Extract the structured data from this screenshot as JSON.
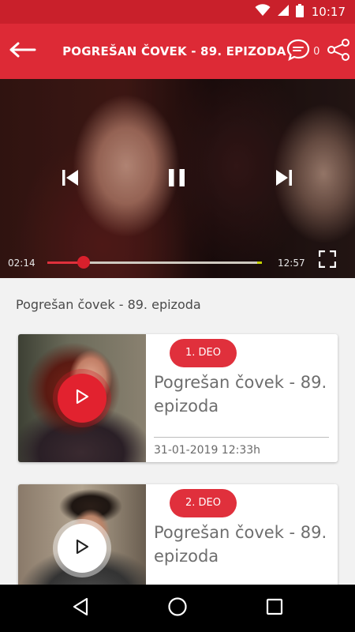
{
  "status_bar": {
    "time": "10:17",
    "icons": [
      "wifi-icon",
      "cell-signal-icon",
      "battery-icon"
    ]
  },
  "app_bar": {
    "title": "POGREŠAN ČOVEK - 89. EPIZODA",
    "comment_count": "0",
    "icons": {
      "back": "arrow-left-icon",
      "comments": "chat-bubble-icon",
      "share": "share-icon"
    }
  },
  "player": {
    "current_time": "02:14",
    "duration": "12:57",
    "progress": 0.17,
    "controls": [
      "skip-previous-icon",
      "pause-icon",
      "skip-next-icon",
      "fullscreen-icon"
    ]
  },
  "episode": {
    "title": "Pogrešan čovek - 89. epizoda",
    "parts": [
      {
        "badge": "1. DEO",
        "title": "Pogrešan čovek - 89. epizoda",
        "date": "31-01-2019 12:33h",
        "playing": true
      },
      {
        "badge": "2. DEO",
        "title": "Pogrešan čovek - 89. epizoda",
        "date": "",
        "playing": false
      }
    ]
  },
  "nav_bar": {
    "icons": [
      "back-triangle-icon",
      "home-circle-icon",
      "recents-square-icon"
    ]
  },
  "colors": {
    "status_bar": "#c9202b",
    "app_bar": "#dd2a36",
    "accent": "#e0303c",
    "background": "#f2f2f2"
  }
}
